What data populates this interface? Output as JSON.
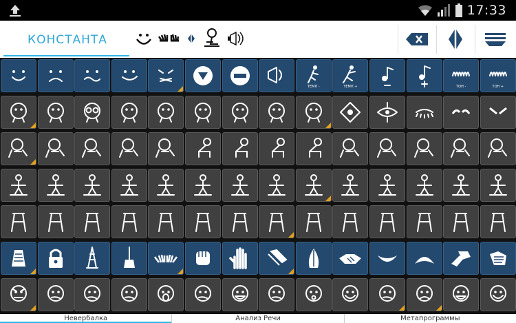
{
  "status": {
    "time": "17:33",
    "upload_icon": "upload-icon",
    "wifi_icon": "wifi-icon",
    "signal_icon": "signal-icon",
    "battery_icon": "battery-icon"
  },
  "toolbar": {
    "title": "КОНСТАНТА",
    "sentence_icons": [
      "smile-icon",
      "hands-icon",
      "diamond-icon",
      "person-icon",
      "speech-icon"
    ],
    "buttons": [
      "backspace-icon",
      "diamond-split-icon",
      "menu-lines-icon"
    ]
  },
  "colors": {
    "accent": "#33b5e5",
    "blue_cell": "#24496e",
    "gray_cell": "#404040",
    "corner": "#e0a020"
  },
  "grid": {
    "rows": [
      [
        {
          "type": "blue",
          "icon": "smile"
        },
        {
          "type": "blue",
          "icon": "frown"
        },
        {
          "type": "blue",
          "icon": "wavy"
        },
        {
          "type": "blue",
          "icon": "smile2"
        },
        {
          "type": "blue",
          "icon": "cross-mouth",
          "corner": true
        },
        {
          "type": "blue",
          "icon": "down-triangle"
        },
        {
          "type": "blue",
          "icon": "minus-circle"
        },
        {
          "type": "blue",
          "icon": "megaphone"
        },
        {
          "type": "blue",
          "icon": "run",
          "label": "ТЕМП -"
        },
        {
          "type": "blue",
          "icon": "run2",
          "label": "ТЕМП +"
        },
        {
          "type": "blue",
          "icon": "note-minus"
        },
        {
          "type": "blue",
          "icon": "note-plus"
        },
        {
          "type": "blue",
          "icon": "tone-minus",
          "label": "ТОН -"
        },
        {
          "type": "blue",
          "icon": "tone-plus",
          "label": "ТОН +"
        }
      ],
      [
        {
          "type": "gray",
          "icon": "head",
          "corner": true
        },
        {
          "type": "gray",
          "icon": "face-eyes"
        },
        {
          "type": "gray",
          "icon": "face-glasses"
        },
        {
          "type": "gray",
          "icon": "face-dots"
        },
        {
          "type": "gray",
          "icon": "face-side"
        },
        {
          "type": "gray",
          "icon": "face-look"
        },
        {
          "type": "gray",
          "icon": "face-down"
        },
        {
          "type": "gray",
          "icon": "face-corner"
        },
        {
          "type": "gray",
          "icon": "face-right",
          "corner": true
        },
        {
          "type": "gray",
          "icon": "eye-diamond"
        },
        {
          "type": "gray",
          "icon": "eye-open"
        },
        {
          "type": "gray",
          "icon": "eye-closed"
        },
        {
          "type": "gray",
          "icon": "brows-up"
        },
        {
          "type": "gray",
          "icon": "brows-down"
        }
      ],
      [
        {
          "type": "gray",
          "icon": "head-turn",
          "corner": true
        },
        {
          "type": "gray",
          "icon": "head-tilt"
        },
        {
          "type": "gray",
          "icon": "head-tilt2"
        },
        {
          "type": "gray",
          "icon": "head-back"
        },
        {
          "type": "gray",
          "icon": "head-down"
        },
        {
          "type": "gray",
          "icon": "body-bend"
        },
        {
          "type": "gray",
          "icon": "body-lean"
        },
        {
          "type": "gray",
          "icon": "body-sit"
        },
        {
          "type": "gray",
          "icon": "body-sit2"
        },
        {
          "type": "gray",
          "icon": "head-circle"
        },
        {
          "type": "gray",
          "icon": "head-side"
        },
        {
          "type": "gray",
          "icon": "head-hands"
        },
        {
          "type": "gray",
          "icon": "head-hood"
        },
        {
          "type": "gray",
          "icon": "head-bow"
        }
      ],
      [
        {
          "type": "gray",
          "icon": "arms-out"
        },
        {
          "type": "gray",
          "icon": "figure-sit"
        },
        {
          "type": "gray",
          "icon": "figure-box"
        },
        {
          "type": "gray",
          "icon": "figure-square"
        },
        {
          "type": "gray",
          "icon": "figure-arms"
        },
        {
          "type": "gray",
          "icon": "figure-door"
        },
        {
          "type": "gray",
          "icon": "figure-squat"
        },
        {
          "type": "gray",
          "icon": "figure-meditate"
        },
        {
          "type": "gray",
          "icon": "figure-desk",
          "corner": true
        },
        {
          "type": "gray",
          "icon": "figure-frame"
        },
        {
          "type": "gray",
          "icon": "figure-cross"
        },
        {
          "type": "gray",
          "icon": "figure-diamond"
        },
        {
          "type": "gray",
          "icon": "figure-stand"
        },
        {
          "type": "gray",
          "icon": "figure-stand2"
        }
      ],
      [
        {
          "type": "gray",
          "icon": "stick-figure"
        },
        {
          "type": "gray",
          "icon": "legs-cross"
        },
        {
          "type": "gray",
          "icon": "legs-k"
        },
        {
          "type": "gray",
          "icon": "legs-x"
        },
        {
          "type": "gray",
          "icon": "legs-kick"
        },
        {
          "type": "gray",
          "icon": "legs-walk"
        },
        {
          "type": "gray",
          "icon": "legs-slash"
        },
        {
          "type": "gray",
          "icon": "legs-table",
          "corner": true
        },
        {
          "type": "gray",
          "icon": "legs-pi"
        },
        {
          "type": "gray",
          "icon": "legs-apart"
        },
        {
          "type": "gray",
          "icon": "legs-wide"
        },
        {
          "type": "gray",
          "icon": "legs-z"
        },
        {
          "type": "gray",
          "icon": "legs-v"
        },
        {
          "type": "gray",
          "icon": "legs-k2"
        }
      ],
      [
        {
          "type": "blue",
          "icon": "cheese-grater",
          "corner": true
        },
        {
          "type": "blue",
          "icon": "lock"
        },
        {
          "type": "blue",
          "icon": "tower"
        },
        {
          "type": "blue",
          "icon": "broom"
        },
        {
          "type": "blue",
          "icon": "hands-pair",
          "corner": true
        },
        {
          "type": "blue",
          "icon": "fist"
        },
        {
          "type": "blue",
          "icon": "palm"
        },
        {
          "type": "blue",
          "icon": "hand-point",
          "corner": true
        },
        {
          "type": "blue",
          "icon": "hands-pray"
        },
        {
          "type": "blue",
          "icon": "handshake"
        },
        {
          "type": "blue",
          "icon": "mouth-smile"
        },
        {
          "type": "blue",
          "icon": "mouth-frown"
        },
        {
          "type": "blue",
          "icon": "hands-clap"
        },
        {
          "type": "blue",
          "icon": "hand-touch"
        }
      ],
      [
        {
          "type": "gray",
          "icon": "face-angry",
          "corner": true
        },
        {
          "type": "gray",
          "icon": "face-grumpy"
        },
        {
          "type": "gray",
          "icon": "face-smirk"
        },
        {
          "type": "gray",
          "icon": "face-worried"
        },
        {
          "type": "gray",
          "icon": "face-scream"
        },
        {
          "type": "gray",
          "icon": "face-nervous"
        },
        {
          "type": "gray",
          "icon": "face-grin"
        },
        {
          "type": "gray",
          "icon": "face-bored"
        },
        {
          "type": "gray",
          "icon": "face-shock"
        },
        {
          "type": "gray",
          "icon": "face-happy"
        },
        {
          "type": "gray",
          "icon": "face-sly",
          "corner": true
        },
        {
          "type": "gray",
          "icon": "face-sad",
          "corner": true
        },
        {
          "type": "gray",
          "icon": "face-teeth"
        },
        {
          "type": "gray",
          "icon": "face-laugh"
        }
      ]
    ]
  },
  "tabs": [
    {
      "label": "Невербалка",
      "active": true
    },
    {
      "label": "Анализ Речи",
      "active": false
    },
    {
      "label": "Метапрограммы",
      "active": false
    }
  ]
}
